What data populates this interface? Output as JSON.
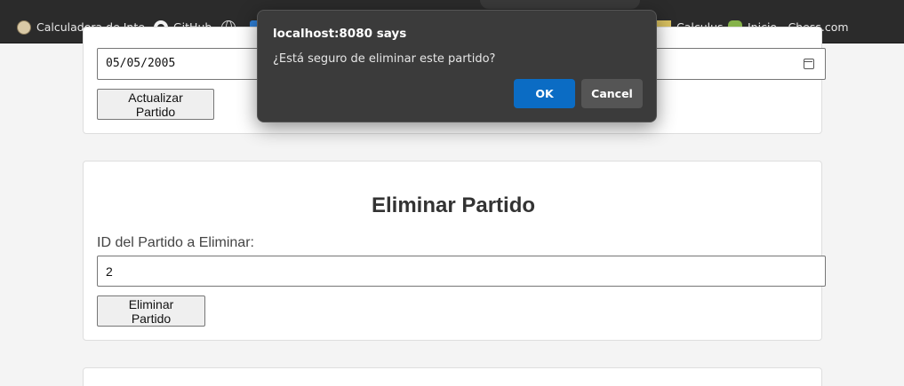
{
  "bookmarks": [
    {
      "label": "Calculadora de Inte...",
      "icon": "calculator-icon"
    },
    {
      "label": "GitHub",
      "icon": "github-icon"
    },
    {
      "label": "",
      "icon": "globe-icon"
    },
    {
      "label": "",
      "icon": "blue-app-icon"
    },
    {
      "label": "Calculus...",
      "icon": "notebook-icon"
    },
    {
      "label": "Inicio - Chess.com",
      "icon": "chess-pawn-icon"
    }
  ],
  "update_section": {
    "date_value": "05/05/2005",
    "button_label": "Actualizar Partido"
  },
  "delete_section": {
    "title": "Eliminar Partido",
    "field_label": "ID del Partido a Eliminar:",
    "field_value": "2",
    "button_label": "Eliminar Partido"
  },
  "dialog": {
    "title": "localhost:8080 says",
    "message": "¿Está seguro de eliminar este partido?",
    "ok_label": "OK",
    "cancel_label": "Cancel",
    "ok_color": "#0b6cc4"
  }
}
